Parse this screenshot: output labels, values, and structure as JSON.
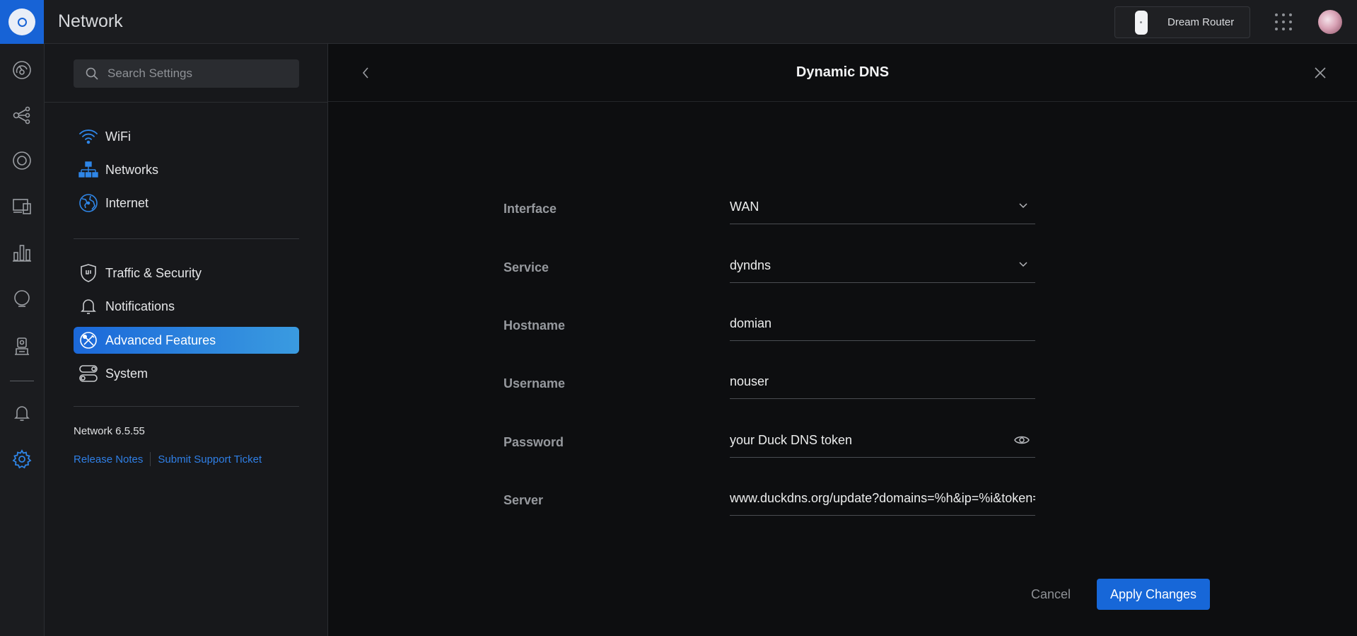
{
  "app": {
    "title": "Network"
  },
  "topbar": {
    "device_name": "Dream Router",
    "apps_icon": "apps-grid-icon",
    "avatar_icon": "user-avatar"
  },
  "rail": {
    "icons": [
      "dashboard-icon",
      "topology-icon",
      "devices-icon",
      "clients-icon",
      "statistics-icon",
      "insights-icon",
      "system-log-icon",
      "notifications-icon",
      "settings-icon"
    ],
    "active": "settings-icon"
  },
  "sidebar": {
    "search_placeholder": "Search Settings",
    "group1": [
      {
        "label": "WiFi",
        "icon": "wifi-icon"
      },
      {
        "label": "Networks",
        "icon": "networks-icon"
      },
      {
        "label": "Internet",
        "icon": "internet-globe-icon"
      }
    ],
    "group2": [
      {
        "label": "Traffic & Security",
        "icon": "shield-icon"
      },
      {
        "label": "Notifications",
        "icon": "bell-icon"
      },
      {
        "label": "Advanced Features",
        "icon": "advanced-features-icon"
      },
      {
        "label": "System",
        "icon": "system-toggle-icon"
      }
    ],
    "active_item": "Advanced Features",
    "version": "Network 6.5.55",
    "release_notes": "Release Notes",
    "support": "Submit Support Ticket"
  },
  "panel": {
    "title": "Dynamic DNS",
    "fields": {
      "interface": {
        "label": "Interface",
        "value": "WAN"
      },
      "service": {
        "label": "Service",
        "value": "dyndns"
      },
      "hostname": {
        "label": "Hostname",
        "value": "domian"
      },
      "username": {
        "label": "Username",
        "value": "nouser"
      },
      "password": {
        "label": "Password",
        "value": "your Duck DNS token"
      },
      "server": {
        "label": "Server",
        "value": "www.duckdns.org/update?domains=%h&ip=%i&token=%p"
      }
    },
    "cancel_label": "Cancel",
    "apply_label": "Apply Changes"
  },
  "colors": {
    "accent": "#1767d8",
    "active_gradient_start": "#1b68d9",
    "active_gradient_end": "#3a9be0",
    "background": "#0d0e10"
  }
}
